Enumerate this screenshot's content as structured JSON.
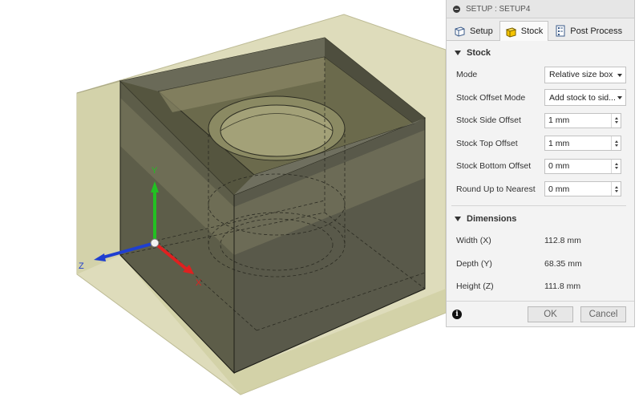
{
  "viewport": {
    "axes": {
      "x": "X",
      "y": "Y",
      "z": "Z"
    }
  },
  "dialog": {
    "title": "SETUP : SETUP4",
    "tabs": [
      {
        "label": "Setup",
        "icon": "setup-icon"
      },
      {
        "label": "Stock",
        "icon": "stock-icon",
        "active": true
      },
      {
        "label": "Post Process",
        "icon": "post-process-icon"
      }
    ],
    "stock_section": {
      "heading": "Stock",
      "mode": {
        "label": "Mode",
        "value": "Relative size box"
      },
      "offset_mode": {
        "label": "Stock Offset Mode",
        "value": "Add stock to sid..."
      },
      "side_offset": {
        "label": "Stock Side Offset",
        "value": "1 mm"
      },
      "top_offset": {
        "label": "Stock Top Offset",
        "value": "1 mm"
      },
      "bottom_offset": {
        "label": "Stock Bottom Offset",
        "value": "0 mm"
      },
      "round_up": {
        "label": "Round Up to Nearest",
        "value": "0 mm"
      }
    },
    "dimensions_section": {
      "heading": "Dimensions",
      "width": {
        "label": "Width (X)",
        "value": "112.8 mm"
      },
      "depth": {
        "label": "Depth (Y)",
        "value": "68.35 mm"
      },
      "height": {
        "label": "Height (Z)",
        "value": "111.8 mm"
      }
    },
    "footer": {
      "ok": "OK",
      "cancel": "Cancel",
      "info_icon": "i"
    }
  },
  "colors": {
    "stock_box": "#d9d8b6",
    "part_body": "#5e5e4a",
    "axis_x": "#e02020",
    "axis_y": "#22c022",
    "axis_z": "#1f3fd0"
  }
}
